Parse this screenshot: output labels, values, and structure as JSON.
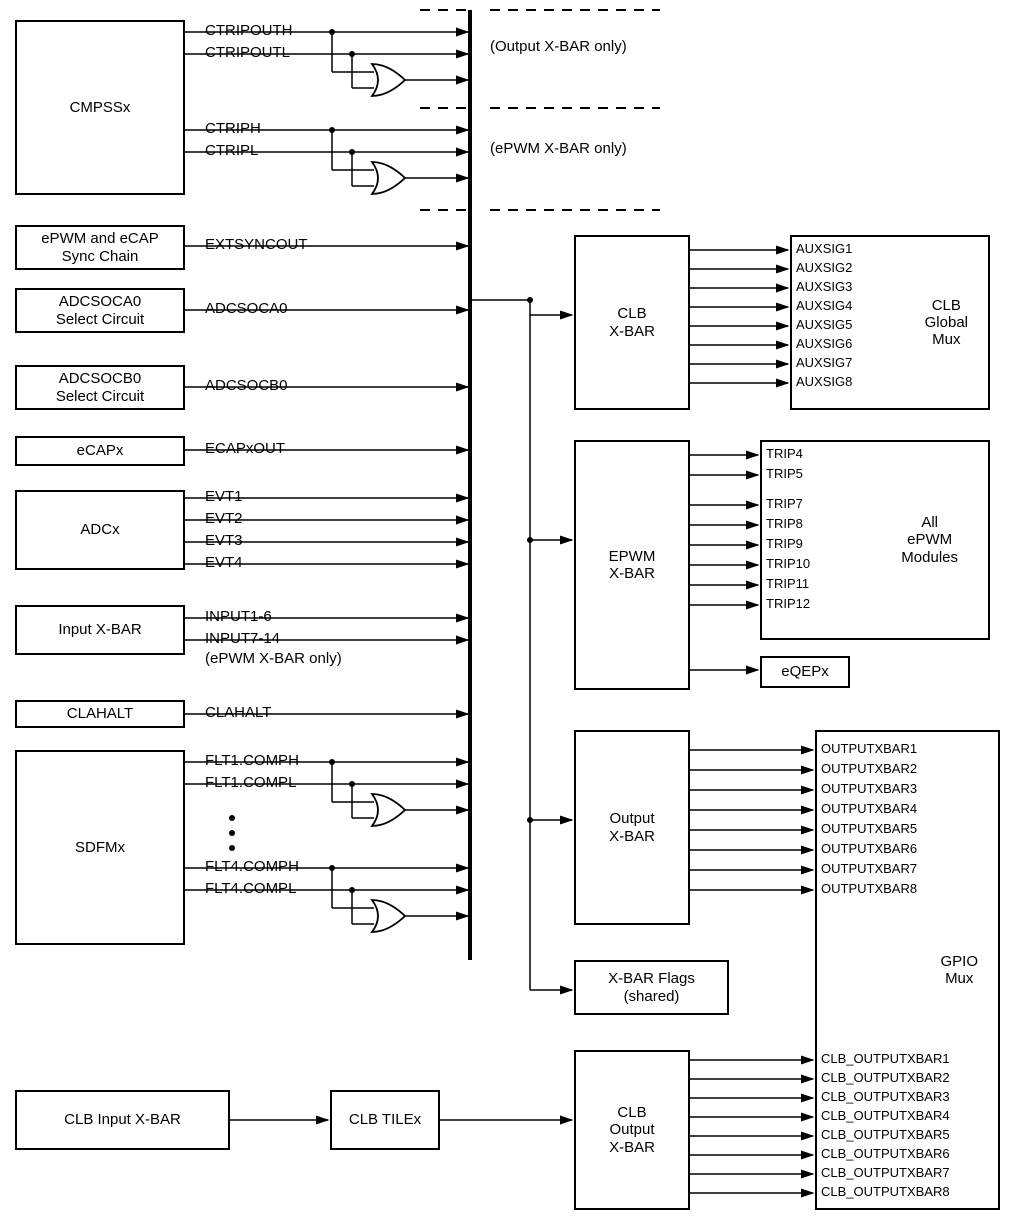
{
  "sources": {
    "cmpssx": "CMPSSx",
    "epwm_ecap_sync": "ePWM and eCAP\nSync Chain",
    "adcsoca0_sel": "ADCSOCA0\nSelect Circuit",
    "adcsocb0_sel": "ADCSOCB0\nSelect Circuit",
    "ecapx": "eCAPx",
    "adcx": "ADCx",
    "input_xbar": "Input X-BAR",
    "clahalt": "CLAHALT",
    "sdfmx": "SDFMx",
    "clb_input_xbar": "CLB Input X-BAR",
    "clb_tilex": "CLB TILEx"
  },
  "signals": {
    "ctripouth": "CTRIPOUTH",
    "ctripoutl": "CTRIPOUTL",
    "ctriph": "CTRIPH",
    "ctripl": "CTRIPL",
    "extsyncout": "EXTSYNCOUT",
    "adcsoca0": "ADCSOCA0",
    "adcsocb0": "ADCSOCB0",
    "ecapxout": "ECAPxOUT",
    "evt1": "EVT1",
    "evt2": "EVT2",
    "evt3": "EVT3",
    "evt4": "EVT4",
    "input1_6": "INPUT1-6",
    "input7_14": "INPUT7-14",
    "epwm_only_note": "(ePWM X-BAR only)",
    "clahalt_sig": "CLAHALT",
    "flt1comph": "FLT1.COMPH",
    "flt1compl": "FLT1.COMPL",
    "flt4comph": "FLT4.COMPH",
    "flt4compl": "FLT4.COMPL"
  },
  "notes": {
    "output_xbar_only": "(Output X-BAR only)",
    "epwm_xbar_only": "(ePWM X-BAR only)"
  },
  "dest_boxes": {
    "clb_xbar": "CLB\nX-BAR",
    "clb_global_mux": "CLB\nGlobal\nMux",
    "epwm_xbar": "EPWM\nX-BAR",
    "all_epwm": "All\nePWM\nModules",
    "eqepx": "eQEPx",
    "output_xbar": "Output\nX-BAR",
    "xbar_flags": "X-BAR Flags\n(shared)",
    "clb_output_xbar": "CLB\nOutput\nX-BAR",
    "gpio_mux": "GPIO\nMux"
  },
  "auxsigs": [
    "AUXSIG1",
    "AUXSIG2",
    "AUXSIG3",
    "AUXSIG4",
    "AUXSIG5",
    "AUXSIG6",
    "AUXSIG7",
    "AUXSIG8"
  ],
  "trips": [
    "TRIP4",
    "TRIP5",
    "TRIP7",
    "TRIP8",
    "TRIP9",
    "TRIP10",
    "TRIP11",
    "TRIP12"
  ],
  "outputxbars": [
    "OUTPUTXBAR1",
    "OUTPUTXBAR2",
    "OUTPUTXBAR3",
    "OUTPUTXBAR4",
    "OUTPUTXBAR5",
    "OUTPUTXBAR6",
    "OUTPUTXBAR7",
    "OUTPUTXBAR8"
  ],
  "clb_outputxbars": [
    "CLB_OUTPUTXBAR1",
    "CLB_OUTPUTXBAR2",
    "CLB_OUTPUTXBAR3",
    "CLB_OUTPUTXBAR4",
    "CLB_OUTPUTXBAR5",
    "CLB_OUTPUTXBAR6",
    "CLB_OUTPUTXBAR7",
    "CLB_OUTPUTXBAR8"
  ],
  "chart_data": {
    "type": "block-diagram",
    "title": "ePWM, CLB, Output X-BAR Architecture",
    "source_blocks": [
      "CMPSSx",
      "ePWM and eCAP Sync Chain",
      "ADCSOCA0 Select Circuit",
      "ADCSOCB0 Select Circuit",
      "eCAPx",
      "ADCx",
      "Input X-BAR",
      "CLAHALT",
      "SDFMx",
      "CLB Input X-BAR",
      "CLB TILEx"
    ],
    "bus_inputs": [
      {
        "block": "CMPSSx",
        "signals": [
          "CTRIPOUTH",
          "CTRIPOUTL",
          "CTRIPH",
          "CTRIPL"
        ],
        "notes": "CTRIPOUTH|L + OR → Output X-BAR only; CTRIPH|L + OR → ePWM X-BAR only"
      },
      {
        "block": "ePWM and eCAP Sync Chain",
        "signals": [
          "EXTSYNCOUT"
        ]
      },
      {
        "block": "ADCSOCA0 Select Circuit",
        "signals": [
          "ADCSOCA0"
        ]
      },
      {
        "block": "ADCSOCB0 Select Circuit",
        "signals": [
          "ADCSOCB0"
        ]
      },
      {
        "block": "eCAPx",
        "signals": [
          "ECAPxOUT"
        ]
      },
      {
        "block": "ADCx",
        "signals": [
          "EVT1",
          "EVT2",
          "EVT3",
          "EVT4"
        ]
      },
      {
        "block": "Input X-BAR",
        "signals": [
          "INPUT1-6",
          "INPUT7-14"
        ],
        "notes": "INPUT7-14 ePWM X-BAR only"
      },
      {
        "block": "CLAHALT",
        "signals": [
          "CLAHALT"
        ]
      },
      {
        "block": "SDFMx",
        "signals": [
          "FLT1.COMPH",
          "FLT1.COMPL",
          "FLT4.COMPH",
          "FLT4.COMPL"
        ],
        "notes": "COMPH|L pairs + OR; FLT1..FLT4"
      }
    ],
    "bus_outputs": [
      {
        "block": "CLB X-BAR",
        "outputs": [
          "AUXSIG1",
          "AUXSIG2",
          "AUXSIG3",
          "AUXSIG4",
          "AUXSIG5",
          "AUXSIG6",
          "AUXSIG7",
          "AUXSIG8"
        ],
        "dest": "CLB Global Mux"
      },
      {
        "block": "EPWM X-BAR",
        "outputs": [
          "TRIP4",
          "TRIP5",
          "TRIP7",
          "TRIP8",
          "TRIP9",
          "TRIP10",
          "TRIP11",
          "TRIP12"
        ],
        "dest": "All ePWM Modules, eQEPx"
      },
      {
        "block": "Output X-BAR",
        "outputs": [
          "OUTPUTXBAR1",
          "OUTPUTXBAR2",
          "OUTPUTXBAR3",
          "OUTPUTXBAR4",
          "OUTPUTXBAR5",
          "OUTPUTXBAR6",
          "OUTPUTXBAR7",
          "OUTPUTXBAR8"
        ],
        "dest": "GPIO Mux"
      },
      {
        "block": "X-BAR Flags (shared)"
      },
      {
        "block": "CLB Output X-BAR",
        "outputs": [
          "CLB_OUTPUTXBAR1",
          "CLB_OUTPUTXBAR2",
          "CLB_OUTPUTXBAR3",
          "CLB_OUTPUTXBAR4",
          "CLB_OUTPUTXBAR5",
          "CLB_OUTPUTXBAR6",
          "CLB_OUTPUTXBAR7",
          "CLB_OUTPUTXBAR8"
        ],
        "dest": "GPIO Mux",
        "fed_by": "CLB TILEx ← CLB Input X-BAR"
      }
    ]
  }
}
